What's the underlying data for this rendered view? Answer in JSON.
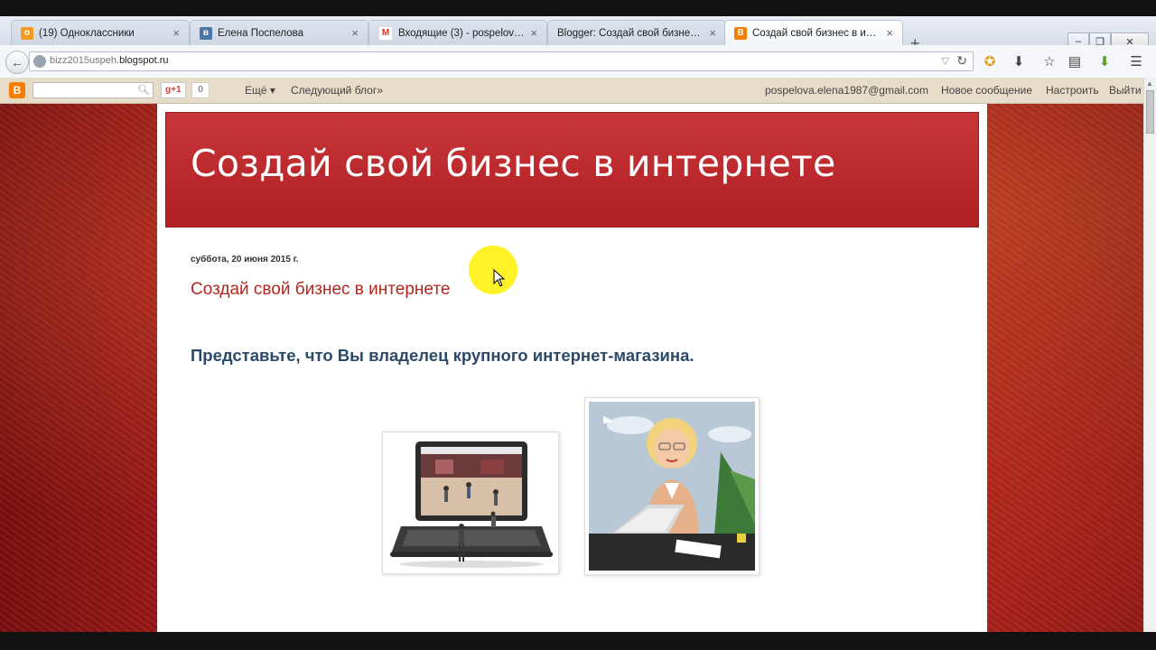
{
  "browser": {
    "tabs": [
      {
        "label": "(19) Одноклассники",
        "favicon": "odnoklassniki-icon",
        "color": "#f29a1e",
        "active": false
      },
      {
        "label": "Елена Поспелова",
        "favicon": "vk-icon",
        "color": "#4a76a8",
        "active": false
      },
      {
        "label": "Входящие (3) - pospelova....",
        "favicon": "gmail-icon",
        "color": "#d93025",
        "active": false
      },
      {
        "label": "Blogger: Создай свой бизнес в...",
        "favicon": "blogger-icon",
        "color": "#f57d00",
        "active": false
      },
      {
        "label": "Создай свой бизнес в инт...",
        "favicon": "blogger-icon",
        "color": "#f57d00",
        "active": true
      }
    ],
    "url_prefix": "bizz2015uspeh.",
    "url_domain": "blogspot.ru"
  },
  "blogger_bar": {
    "gplus_label": "g+1",
    "gplus_count": "0",
    "more": "Ещё ▾",
    "next_blog": "Следующий блог»",
    "email": "pospelova.elena1987@gmail.com",
    "new_post": "Новое сообщение",
    "customize": "Настроить",
    "sign_out": "Выйти"
  },
  "blog": {
    "header_title": "Создай свой бизнес в интернете",
    "date": "суббота, 20 июня 2015 г.",
    "post_title": "Создай свой бизнес в интернете",
    "subheading": "Представьте, что Вы владелец крупного интернет-магазина."
  },
  "colors": {
    "header_red": "#b3262a",
    "post_title": "#b3261e",
    "subheading": "#2b4a6a",
    "page_bg": "#a01a18"
  }
}
